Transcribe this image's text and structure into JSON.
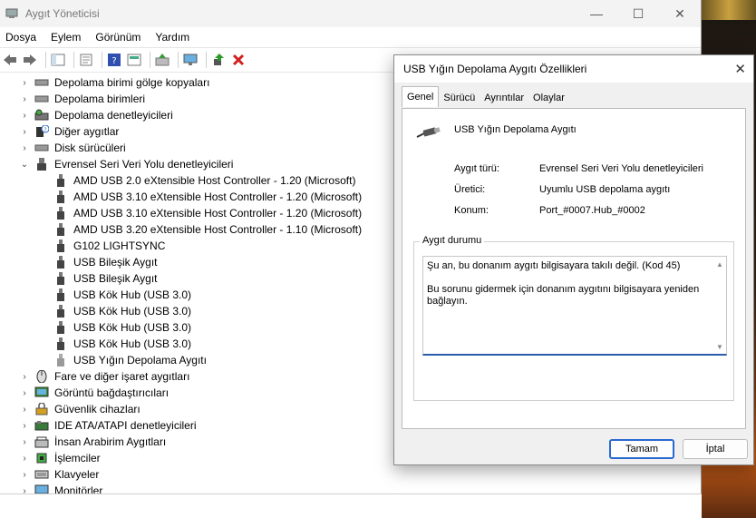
{
  "window": {
    "title": "Aygıt Yöneticisi",
    "minimize": "—",
    "maximize": "☐",
    "close": "✕"
  },
  "menu": [
    "Dosya",
    "Eylem",
    "Görünüm",
    "Yardım"
  ],
  "tree": {
    "categories_top": [
      {
        "label": "Depolama birimi gölge kopyaları",
        "icon": "drive-icon"
      },
      {
        "label": "Depolama birimleri",
        "icon": "drive-icon"
      },
      {
        "label": "Depolama denetleyicileri",
        "icon": "storage-controller-icon"
      },
      {
        "label": "Diğer aygıtlar",
        "icon": "unknown-device-icon"
      },
      {
        "label": "Disk sürücüleri",
        "icon": "drive-icon"
      }
    ],
    "usb_category": {
      "label": "Evrensel Seri Veri Yolu denetleyicileri",
      "icon": "usb-icon"
    },
    "usb_children": [
      "AMD USB 2.0 eXtensible Host Controller - 1.20 (Microsoft)",
      "AMD USB 3.10 eXtensible Host Controller - 1.20 (Microsoft)",
      "AMD USB 3.10 eXtensible Host Controller - 1.20 (Microsoft)",
      "AMD USB 3.20 eXtensible Host Controller - 1.10 (Microsoft)",
      "G102 LIGHTSYNC",
      "USB Bileşik Aygıt",
      "USB Bileşik Aygıt",
      "USB Kök Hub (USB 3.0)",
      "USB Kök Hub (USB 3.0)",
      "USB Kök Hub (USB 3.0)",
      "USB Kök Hub (USB 3.0)",
      "USB Yığın Depolama Aygıtı"
    ],
    "categories_bottom": [
      {
        "label": "Fare ve diğer işaret aygıtları",
        "icon": "mouse-icon"
      },
      {
        "label": "Görüntü bağdaştırıcıları",
        "icon": "display-adapter-icon"
      },
      {
        "label": "Güvenlik cihazları",
        "icon": "security-device-icon"
      },
      {
        "label": "IDE ATA/ATAPI denetleyicileri",
        "icon": "ide-controller-icon"
      },
      {
        "label": "İnsan Arabirim Aygıtları",
        "icon": "hid-icon"
      },
      {
        "label": "İşlemciler",
        "icon": "processor-icon"
      },
      {
        "label": "Klavyeler",
        "icon": "keyboard-icon"
      },
      {
        "label": "Monitörler",
        "icon": "monitor-icon"
      }
    ]
  },
  "dialog": {
    "title": "USB Yığın Depolama Aygıtı Özellikleri",
    "close": "✕",
    "tabs": [
      "Genel",
      "Sürücü",
      "Ayrıntılar",
      "Olaylar"
    ],
    "device_name": "USB Yığın Depolama Aygıtı",
    "props": [
      {
        "label": "Aygıt türü:",
        "value": "Evrensel Seri Veri Yolu denetleyicileri"
      },
      {
        "label": "Üretici:",
        "value": "Uyumlu USB depolama aygıtı"
      },
      {
        "label": "Konum:",
        "value": "Port_#0007.Hub_#0002"
      }
    ],
    "status_group": "Aygıt durumu",
    "status_line1": "Şu an, bu donanım aygıtı bilgisayara takılı değil. (Kod 45)",
    "status_line2": "Bu sorunu gidermek için donanım aygıtını bilgisayara yeniden bağlayın.",
    "ok": "Tamam",
    "cancel": "İptal"
  },
  "colors": {
    "accent": "#2a6ad0",
    "error_red": "#d21f1f"
  }
}
